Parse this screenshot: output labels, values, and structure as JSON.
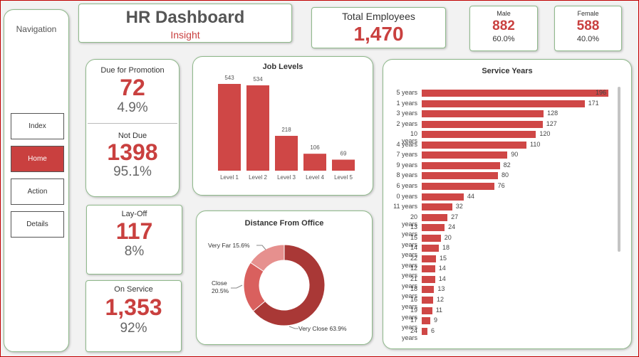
{
  "nav": {
    "title": "Navigation",
    "buttons": [
      "Index",
      "Home",
      "Action",
      "Details"
    ],
    "active": "Home"
  },
  "header": {
    "title": "HR Dashboard",
    "subtitle": "Insight"
  },
  "total": {
    "label": "Total Employees",
    "value": "1,470"
  },
  "male": {
    "label": "Male",
    "value": "882",
    "pct": "60.0%"
  },
  "female": {
    "label": "Female",
    "value": "588",
    "pct": "40.0%"
  },
  "promotion": {
    "due_label": "Due for Promotion",
    "due_value": "72",
    "due_pct": "4.9%",
    "not_label": "Not Due",
    "not_value": "1398",
    "not_pct": "95.1%"
  },
  "layoff": {
    "label": "Lay-Off",
    "value": "117",
    "pct": "8%"
  },
  "onservice": {
    "label": "On Service",
    "value": "1,353",
    "pct": "92%"
  },
  "colors": {
    "accent": "#c9403f",
    "border": "#8fb98b",
    "donut": [
      "#a93836",
      "#d9605e",
      "#e6908e"
    ]
  },
  "chart_data": [
    {
      "type": "bar",
      "title": "Job Levels",
      "categories": [
        "Level 1",
        "Level 2",
        "Level 3",
        "Level 4",
        "Level 5"
      ],
      "values": [
        543,
        534,
        218,
        106,
        69
      ]
    },
    {
      "type": "pie",
      "title": "Distance From Office",
      "labels": [
        "Very Close",
        "Close",
        "Very Far"
      ],
      "values": [
        63.9,
        20.5,
        15.6
      ],
      "display": [
        "Very Close 63.9%",
        "Close 20.5%",
        "Very Far 15.6%"
      ]
    },
    {
      "type": "bar",
      "title": "Service Years",
      "categories": [
        "5 years",
        "1 years",
        "3 years",
        "2 years",
        "10 years",
        "4 years",
        "7 years",
        "9 years",
        "8 years",
        "6 years",
        "0 years",
        "11 years",
        "20 years",
        "13 years",
        "15 years",
        "14 years",
        "22 years",
        "12 years",
        "21 years",
        "18 years",
        "16 years",
        "19 years",
        "17 years",
        "24 years"
      ],
      "values": [
        196,
        171,
        128,
        127,
        120,
        110,
        90,
        82,
        80,
        76,
        44,
        32,
        27,
        24,
        20,
        18,
        15,
        14,
        14,
        13,
        12,
        11,
        9,
        6
      ]
    }
  ]
}
